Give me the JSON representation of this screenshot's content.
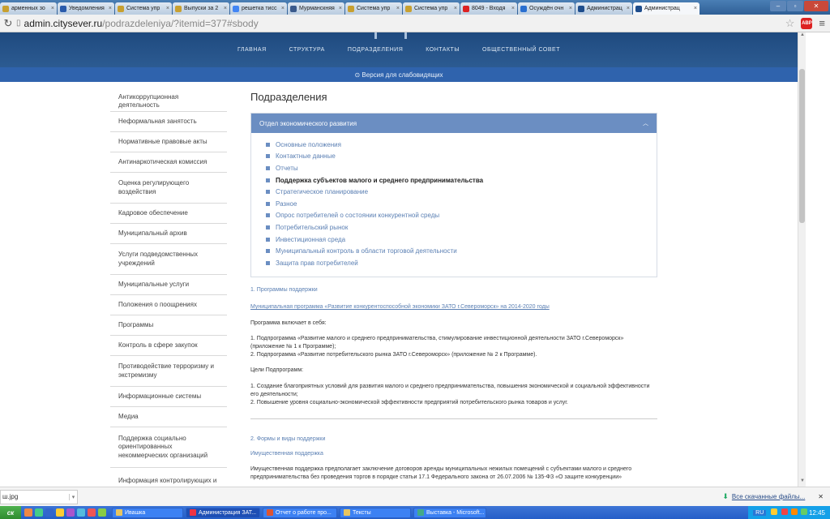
{
  "browser": {
    "tabs": [
      {
        "label": "арменных зо",
        "color": "#c8a030"
      },
      {
        "label": "Уведомления",
        "color": "#2a5bab"
      },
      {
        "label": "Система упр",
        "color": "#c8a030"
      },
      {
        "label": "Выпуски за 2",
        "color": "#c8a030"
      },
      {
        "label": "решетка тисс",
        "color": "#4285f4"
      },
      {
        "label": "Мурманскняя",
        "color": "#3a5a8c"
      },
      {
        "label": "Система упр",
        "color": "#c8a030"
      },
      {
        "label": "Система упр",
        "color": "#c8a030"
      },
      {
        "label": "8049 - Входя",
        "color": "#d22"
      },
      {
        "label": "Осуждён очн",
        "color": "#2a6fd0"
      },
      {
        "label": "Администрац",
        "color": "#1e4d8c"
      },
      {
        "label": "Администрац",
        "color": "#1e4d8c"
      }
    ],
    "url_host": "admin.citysever.ru",
    "url_path": "/podrazdeleniya/?itemid=377#sbody"
  },
  "site": {
    "nav": [
      "ГЛАВНАЯ",
      "СТРУКТУРА",
      "ПОДРАЗДЕЛЕНИЯ",
      "КОНТАКТЫ",
      "ОБЩЕСТВЕННЫЙ СОВЕТ"
    ],
    "accessibility": "⊙ Версия для слабовидящих"
  },
  "sidebar": {
    "items": [
      "Антикоррупционная деятельность",
      "Неформальная занятость",
      "Нормативные правовые акты",
      "Антинаркотическая комиссия",
      "Оценка регулирующего воздействия",
      "Кадровое обеспечение",
      "Муниципальный архив",
      "Услуги подведомственных учреждений",
      "Муниципальные услуги",
      "Положения о поощрениях",
      "Программы",
      "Контроль в сфере закупок",
      "Противодействие терроризму и экстремизму",
      "Информационные системы",
      "Медиа",
      "Поддержка социально ориентированных некоммерческих организаций",
      "Информация контролирующих и"
    ]
  },
  "main": {
    "title": "Подразделения",
    "accordion": {
      "header": "Отдел экономического развития",
      "links": [
        "Основные положения",
        "Контактные данные",
        "Отчеты",
        "Поддержка субъектов малого и среднего предпринимательства",
        "Стратегическое планирование",
        "Разное",
        "Опрос потребителей о состоянии конкурентной среды",
        "Потребительский рынок",
        "Инвестиционная среда",
        "Муниципальный контроль в области торговой деятельности",
        "Защита прав потребителей"
      ]
    },
    "section1": {
      "heading": "1. Программы поддержки",
      "program_link": "Муниципальная программа «Развитие конкурентоспособной экономики ЗАТО г.Североморск» на 2014-2020 годы",
      "includes": "Программа включает в себя:",
      "sub1": "1. Подпрограмма «Развитие малого и среднего предпринимательства, стимулирование инвестиционной деятельности ЗАТО г.Североморск» (приложение № 1 к Программе);",
      "sub2": "2. Подпрограмма «Развитие потребительского рынка ЗАТО г.Североморск» (приложение № 2 к Программе).",
      "goals_title": "Цели Подпрограмм:",
      "goal1": "1. Создание благоприятных условий для развития малого и среднего предпринимательства, повышения экономической и социальной эффективности его деятельности;",
      "goal2": "2. Повышение уровня социально-экономической эффективности предприятий потребительского рынка товаров и услуг."
    },
    "section2": {
      "heading": "2. Формы и виды поддержки",
      "subheading": "Имущественная поддержка",
      "text": "Имущественная поддержка предполагает заключение договоров аренды муниципальных нежилых помещений с субъектами малого и среднего предпринимательства без проведения торгов в порядке статьи 17.1 Федерального закона от 26.07.2006 № 135-ФЗ «О защите конкуренции»"
    }
  },
  "downloads": {
    "file": "ш.jpg",
    "all": "Все скачанные файлы..."
  },
  "taskbar": {
    "start": "ск",
    "tasks": [
      {
        "label": "Ивашка",
        "color": "#e8c560"
      },
      {
        "label": "Администрация ЗАТ...",
        "color": "#e34",
        "active": true
      },
      {
        "label": "Отчет о работе про...",
        "color": "#d53"
      },
      {
        "label": "Тексты",
        "color": "#e8c560"
      },
      {
        "label": "Выставка - Microsoft...",
        "color": "#4a8"
      }
    ],
    "lang": "RU",
    "time": "12:45"
  }
}
